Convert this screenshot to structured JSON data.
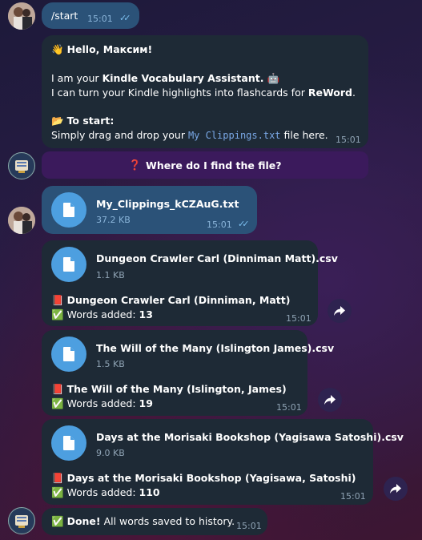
{
  "messages": {
    "start": {
      "text": "/start",
      "time": "15:01"
    },
    "welcome": {
      "greeting_emoji": "👋",
      "greeting": "Hello, Максим!",
      "intro_pre": "I am your ",
      "intro_bold": "Kindle Vocabulary Assistant.",
      "intro_emoji": "🤖",
      "line2_pre": "I can turn your Kindle highlights into flashcards for ",
      "line2_bold": "ReWord",
      "line2_post": ".",
      "start_emoji": "📂",
      "start_label": "To start:",
      "drag_pre": "Simply drag and drop your ",
      "drag_file": "My Clippings.txt",
      "drag_post": " file here.",
      "time": "15:01"
    },
    "help_button": {
      "emoji": "❓",
      "label": "Where do I find the file?"
    },
    "upload": {
      "filename": "My_Clippings_kCZAuG.txt",
      "size": "37.2 KB",
      "time": "15:01"
    },
    "files": [
      {
        "filename": "Dungeon Crawler Carl (Dinniman Matt).csv",
        "size": "1.1 KB",
        "book_emoji": "📕",
        "book": "Dungeon Crawler Carl (Dinniman, Matt)",
        "check": "✅",
        "words_label": "Words added:",
        "words": "13",
        "time": "15:01"
      },
      {
        "filename": "The Will of the Many (Islington James).csv",
        "size": "1.5 KB",
        "book_emoji": "📕",
        "book": "The Will of the Many (Islington, James)",
        "check": "✅",
        "words_label": "Words added:",
        "words": "19",
        "time": "15:01"
      },
      {
        "filename": "Days at the Morisaki Bookshop (Yagisawa Satoshi).csv",
        "size": "9.0 KB",
        "book_emoji": "📕",
        "book": "Days at the Morisaki Bookshop (Yagisawa, Satoshi)",
        "check": "✅",
        "words_label": "Words added:",
        "words": "110",
        "time": "15:01"
      }
    ],
    "done": {
      "check": "✅",
      "bold": "Done!",
      "text": " All words saved to history.",
      "time": "15:01"
    }
  },
  "ticks": "✓✓"
}
